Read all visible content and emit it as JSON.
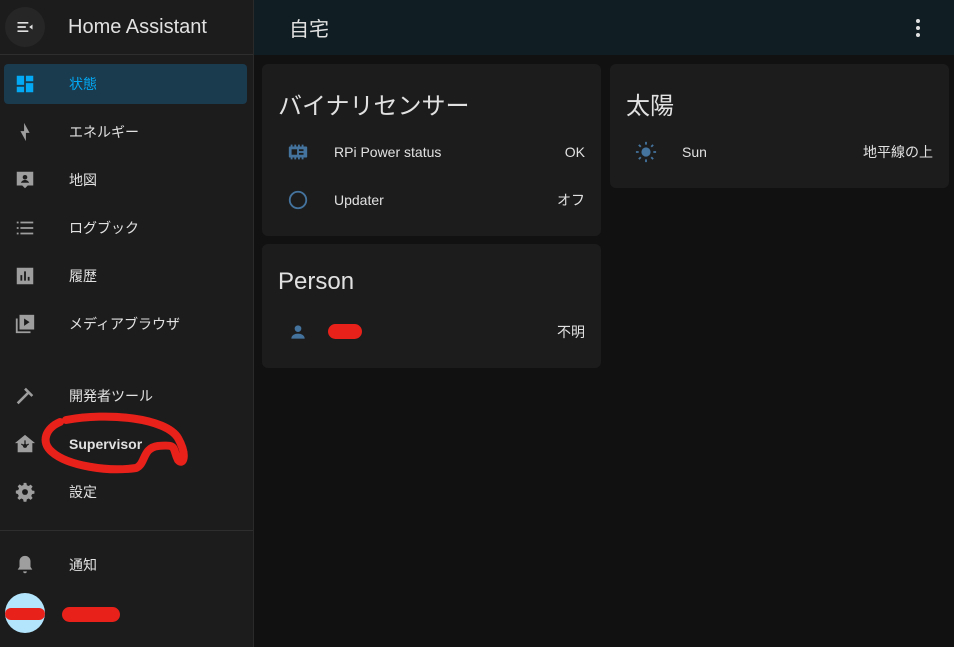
{
  "sidebar": {
    "title": "Home Assistant",
    "items": [
      {
        "label": "状態",
        "icon": "dashboard-icon",
        "active": true
      },
      {
        "label": "エネルギー",
        "icon": "lightning-bolt-icon"
      },
      {
        "label": "地図",
        "icon": "map-icon"
      },
      {
        "label": "ログブック",
        "icon": "list-icon"
      },
      {
        "label": "履歴",
        "icon": "chart-icon"
      },
      {
        "label": "メディアブラウザ",
        "icon": "play-box-icon"
      },
      {
        "label": "開発者ツール",
        "icon": "hammer-icon"
      },
      {
        "label": "Supervisor",
        "icon": "supervisor-home-icon"
      },
      {
        "label": "設定",
        "icon": "gear-icon"
      }
    ],
    "notifications_label": "通知"
  },
  "topbar": {
    "title": "自宅"
  },
  "cards": {
    "binary_sensor": {
      "title": "バイナリセンサー",
      "rows": [
        {
          "name": "RPi Power status",
          "state": "OK",
          "icon": "raspberry-pi-icon"
        },
        {
          "name": "Updater",
          "state": "オフ",
          "icon": "circle-outline-icon"
        }
      ]
    },
    "person": {
      "title": "Person",
      "rows": [
        {
          "state": "不明",
          "icon": "person-icon"
        }
      ]
    },
    "sun": {
      "title": "太陽",
      "rows": [
        {
          "name": "Sun",
          "state": "地平線の上",
          "icon": "sun-icon"
        }
      ]
    }
  },
  "colors": {
    "accent": "#03a9f4",
    "icon": "#44739e",
    "annotation_red": "#e8211a"
  }
}
